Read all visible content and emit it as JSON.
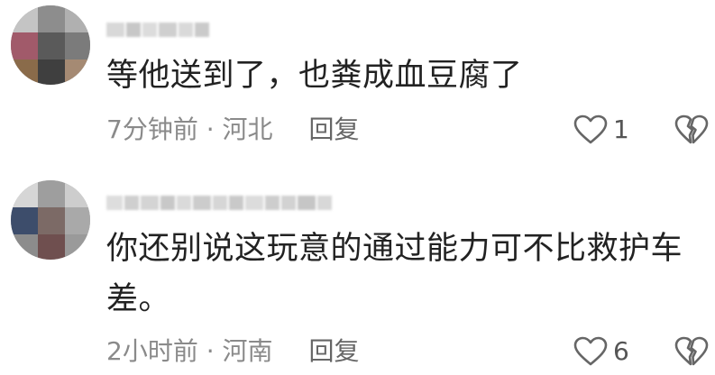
{
  "comments": [
    {
      "text": "等他送到了，也粪成血豆腐了",
      "time": "7分钟前 · 河北",
      "reply_label": "回复",
      "like_count": "1"
    },
    {
      "text": "你还别说这玩意的通过能力可不比救护车\n差。",
      "time": "2小时前 · 河南",
      "reply_label": "回复",
      "like_count": "6"
    }
  ],
  "icons": {
    "like": "heart-outline-icon",
    "dislike": "broken-heart-icon"
  },
  "colors": {
    "text": "#222222",
    "meta": "#8a8a8a",
    "icon": "#666666"
  }
}
